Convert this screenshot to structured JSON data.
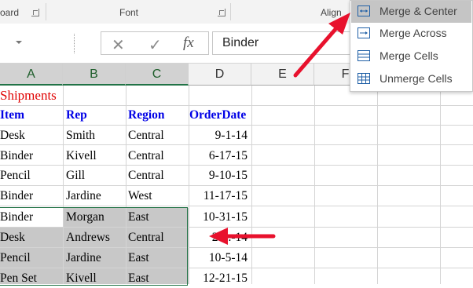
{
  "ribbon": {
    "clipboard_label": "oard",
    "font_label": "Font",
    "alignment_label": "Align"
  },
  "formula_bar": {
    "cancel_icon": "cancel-x-icon",
    "enter_icon": "enter-check-icon",
    "function_label": "fx",
    "value": "Binder"
  },
  "columns": [
    "A",
    "B",
    "C",
    "D",
    "E",
    "F"
  ],
  "sheet": {
    "title": "Shipments",
    "headers": [
      "Item",
      "Rep",
      "Region",
      "OrderDate"
    ],
    "rows": [
      [
        "Desk",
        "Smith",
        "Central",
        "9-1-14"
      ],
      [
        "Binder",
        "Kivell",
        "Central",
        "6-17-15"
      ],
      [
        "Pencil",
        "Gill",
        "Central",
        "9-10-15"
      ],
      [
        "Binder",
        "Jardine",
        "West",
        "11-17-15"
      ],
      [
        "Binder",
        "Morgan",
        "East",
        "10-31-15"
      ],
      [
        "Desk",
        "Andrews",
        "Central",
        "2-...-14"
      ],
      [
        "Pencil",
        "Jardine",
        "East",
        "10-5-14"
      ],
      [
        "Pen Set",
        "Kivell",
        "East",
        "12-21-15"
      ]
    ]
  },
  "merge_menu": {
    "items": [
      {
        "label": "Merge & Center",
        "icon": "merge-center-icon"
      },
      {
        "label": "Merge Across",
        "icon": "merge-across-icon"
      },
      {
        "label": "Merge Cells",
        "icon": "merge-cells-icon"
      },
      {
        "label": "Unmerge Cells",
        "icon": "unmerge-cells-icon"
      }
    ]
  },
  "colors": {
    "arrow": "#e8112d",
    "selection_border": "#217346",
    "header_text": "#0000e6",
    "title_text": "#e00000"
  }
}
